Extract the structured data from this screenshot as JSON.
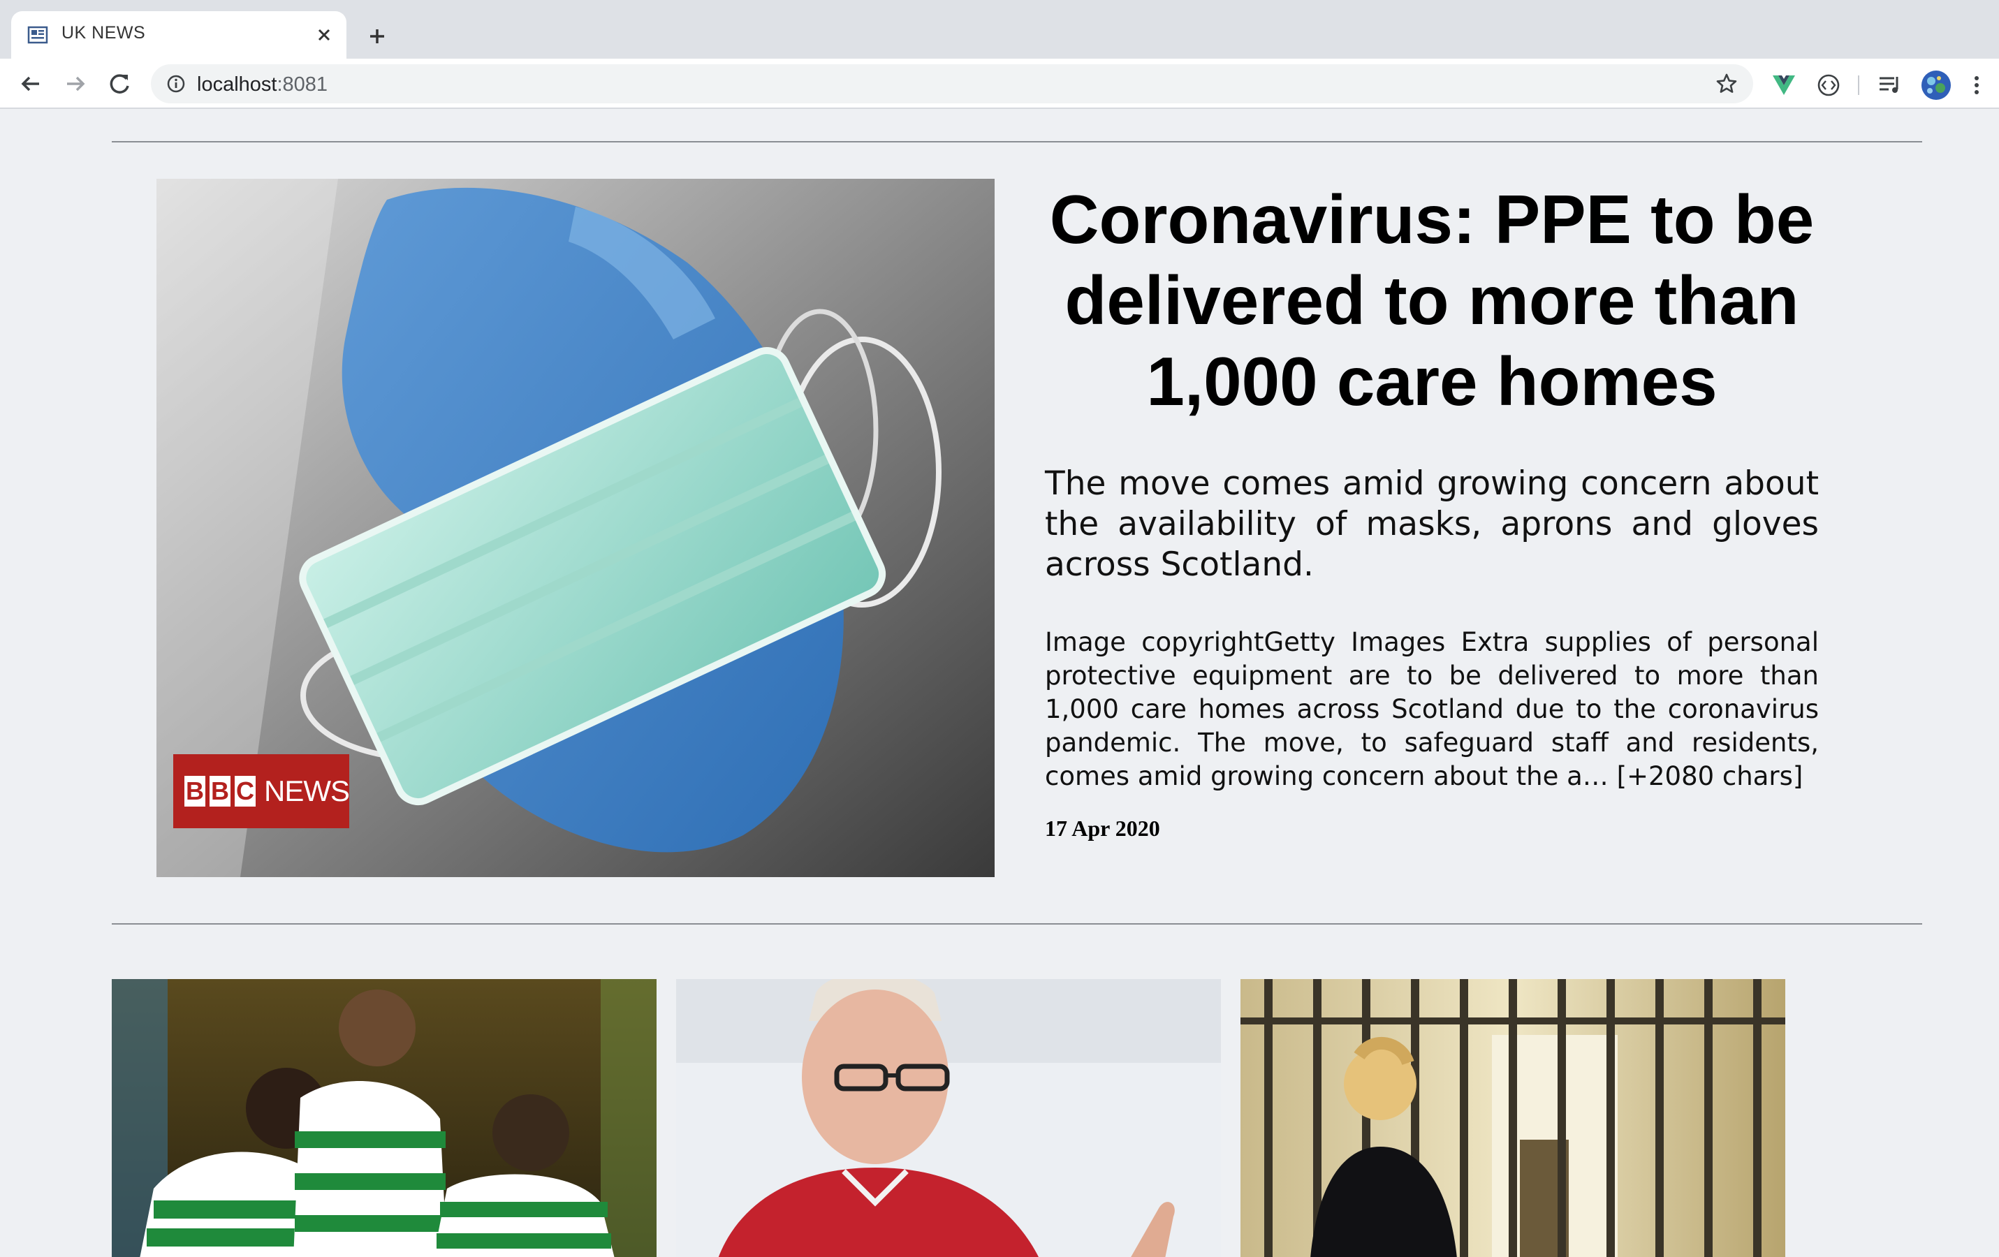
{
  "browser": {
    "tab_title": "UK NEWS",
    "url_host": "localhost",
    "url_port": ":8081"
  },
  "hero": {
    "title": "Coronavirus: PPE to be delivered to more than 1,000 care homes",
    "subtitle": "The move comes amid growing concern about the availability of masks, aprons and gloves across Scotland.",
    "body": "Image copyrightGetty Images Extra supplies of personal protective equipment are to be delivered to more than 1,000 care homes across Scotland due to the coronavirus pandemic. The move, to safeguard staff and residents, comes amid growing concern about the a… [+2080 chars]",
    "date": "17 Apr 2020",
    "image_logo": {
      "letters": [
        "B",
        "B",
        "C"
      ],
      "word": "NEWS"
    }
  },
  "cards": [
    {
      "image": "football-players-celebrating-photo"
    },
    {
      "image": "coach-in-red-shirt-photo"
    },
    {
      "image": "prison-officer-corridor-photo"
    }
  ],
  "colors": {
    "bbc_red": "#b3211e",
    "page_bg": "#eef0f3"
  }
}
